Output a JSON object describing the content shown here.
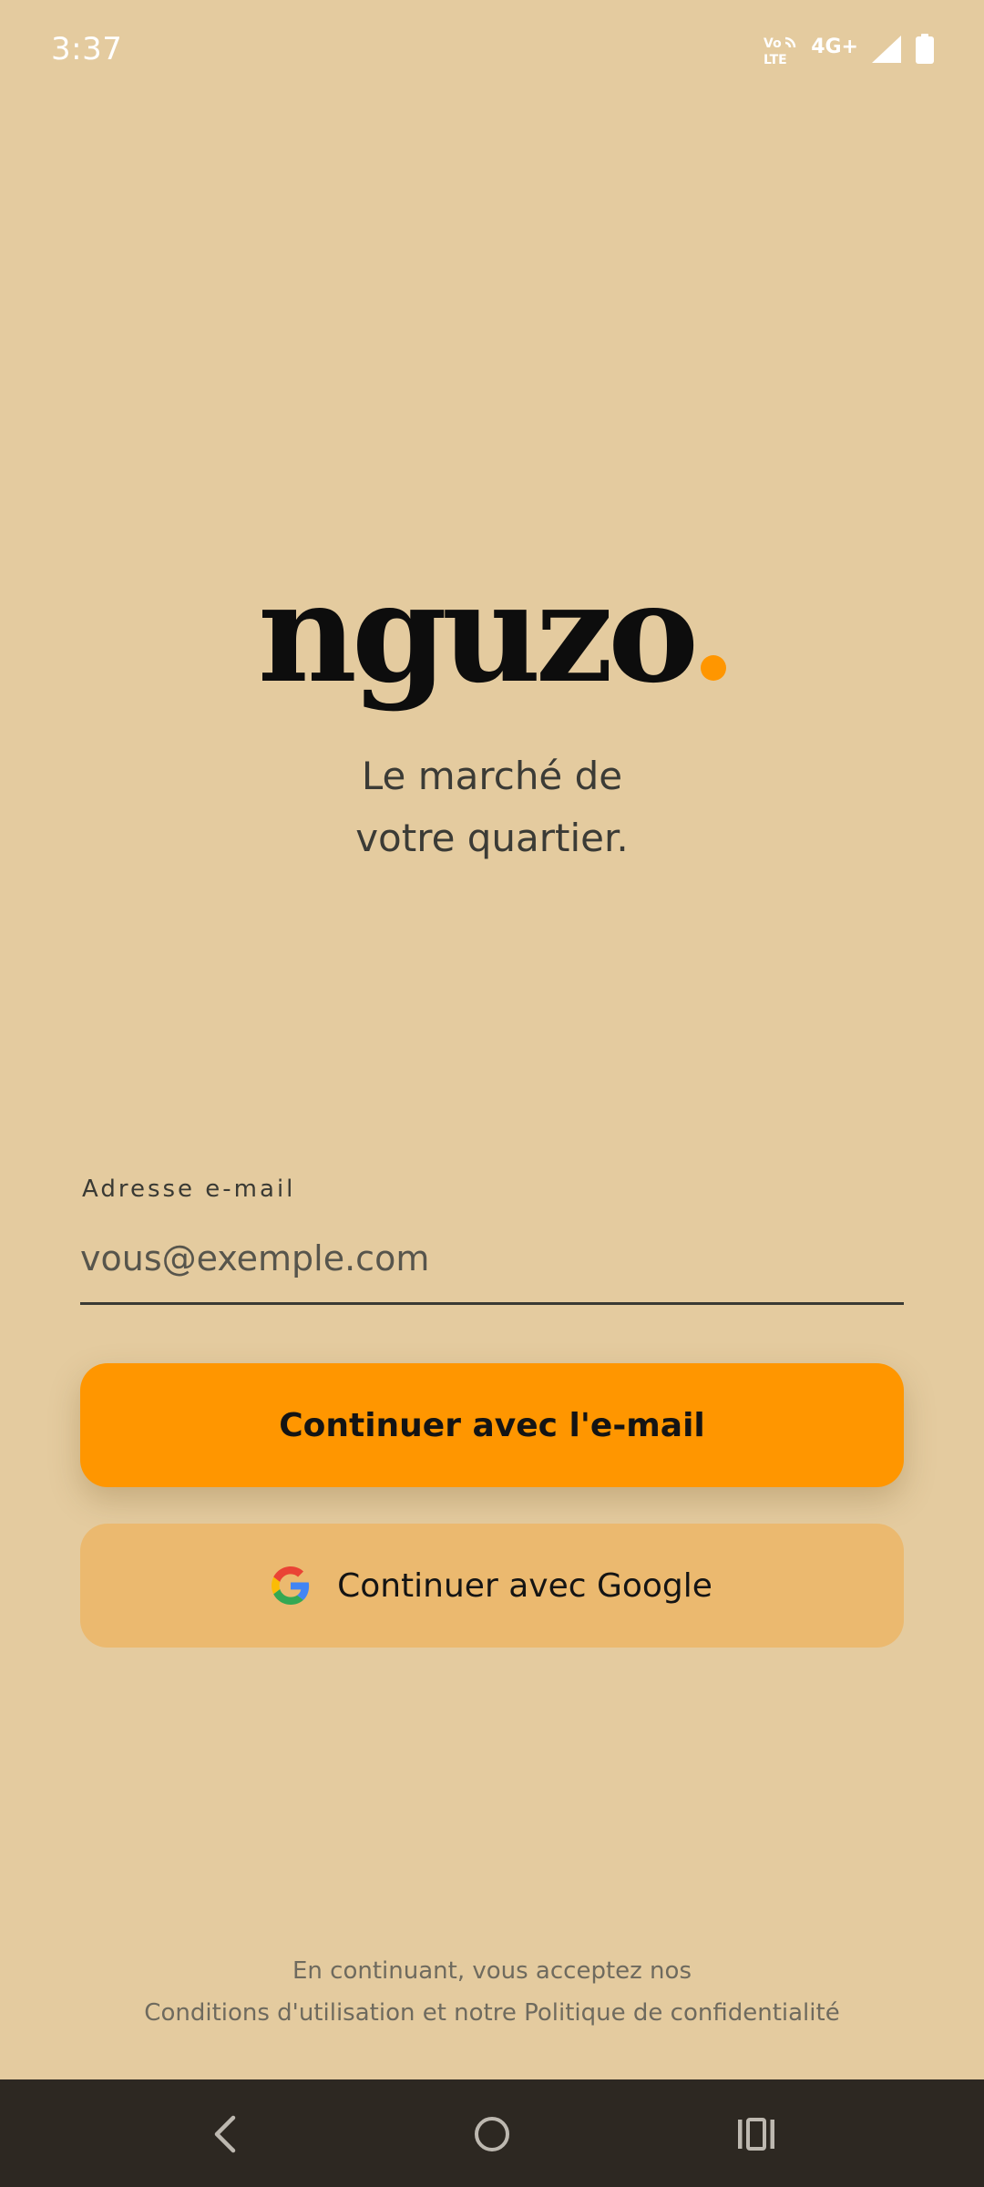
{
  "status_bar": {
    "time": "3:37",
    "volte_top": "Vo",
    "volte_bottom": "LTE",
    "network": "4G+",
    "icons": [
      "volte-icon",
      "signal-icon",
      "battery-icon"
    ]
  },
  "brand": {
    "name": "nguzo",
    "accent_color": "#FF9600",
    "background_color": "#E4CB9F"
  },
  "tagline": {
    "line1": "Le marché de",
    "line2": "votre quartier."
  },
  "email_field": {
    "label": "Adresse e-mail",
    "placeholder": "vous@exemple.com",
    "value": ""
  },
  "buttons": {
    "email_label": "Continuer avec l'e-mail",
    "email_color": "#FF9600",
    "google_label": "Continuer avec Google",
    "google_color": "#EBB96F",
    "google_icon": "google-icon"
  },
  "legal": {
    "line1": "En continuant, vous acceptez nos",
    "line2": "Conditions d'utilisation et notre Politique de confidentialité"
  },
  "nav_bar": {
    "icons": [
      "back-icon",
      "home-icon",
      "recents-icon"
    ]
  }
}
